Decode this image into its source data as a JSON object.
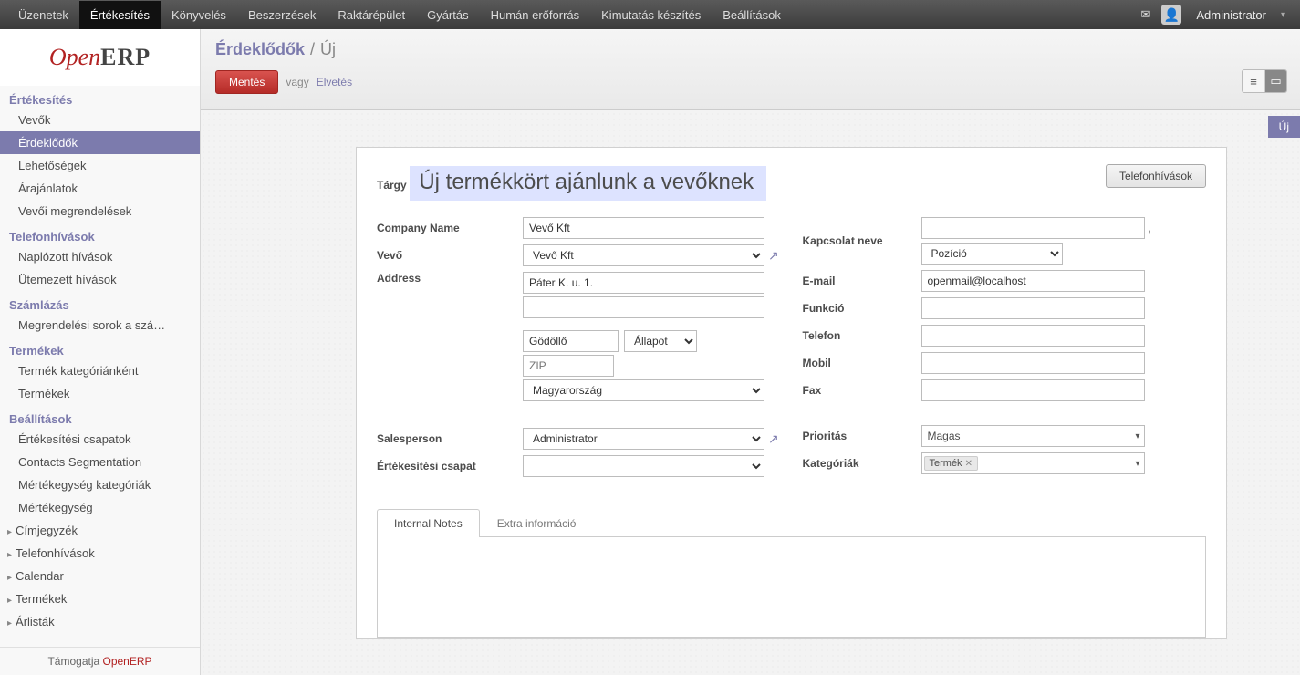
{
  "topmenu": {
    "items": [
      "Üzenetek",
      "Értékesítés",
      "Könyvelés",
      "Beszerzések",
      "Raktárépület",
      "Gyártás",
      "Humán erőforrás",
      "Kimutatás készítés",
      "Beállítások"
    ],
    "active_index": 1,
    "username": "Administrator"
  },
  "logo": {
    "open": "Open",
    "erp": "ERP"
  },
  "sidebar": {
    "sections": [
      {
        "title": "Értékesítés",
        "items": [
          {
            "label": "Vevők"
          },
          {
            "label": "Érdeklődők",
            "active": true
          },
          {
            "label": "Lehetőségek"
          },
          {
            "label": "Árajánlatok"
          },
          {
            "label": "Vevői megrendelések"
          }
        ]
      },
      {
        "title": "Telefonhívások",
        "items": [
          {
            "label": "Naplózott hívások"
          },
          {
            "label": "Ütemezett hívások"
          }
        ]
      },
      {
        "title": "Számlázás",
        "items": [
          {
            "label": "Megrendelési sorok a szá…"
          }
        ]
      },
      {
        "title": "Termékek",
        "items": [
          {
            "label": "Termék kategóriánként"
          },
          {
            "label": "Termékek"
          }
        ]
      },
      {
        "title": "Beállítások",
        "items": [
          {
            "label": "Értékesítési csapatok"
          },
          {
            "label": "Contacts Segmentation"
          },
          {
            "label": "Mértékegység kategóriák"
          },
          {
            "label": "Mértékegység"
          },
          {
            "label": "Címjegyzék",
            "expandable": true
          },
          {
            "label": "Telefonhívások",
            "expandable": true
          },
          {
            "label": "Calendar",
            "expandable": true
          },
          {
            "label": "Termékek",
            "expandable": true
          },
          {
            "label": "Árlisták",
            "expandable": true
          }
        ]
      }
    ],
    "footer_prefix": "Támogatja ",
    "footer_brand": "OpenERP"
  },
  "header": {
    "breadcrumb_root": "Érdeklődők",
    "breadcrumb_current": "Új",
    "save": "Mentés",
    "or": "vagy",
    "discard": "Elvetés",
    "status_tag": "Új"
  },
  "form": {
    "subject_label": "Tárgy",
    "subject_value": "Új termékkört ajánlunk a vevőknek",
    "phone_calls_button": "Telefonhívások",
    "company_name_label": "Company Name",
    "company_name_value": "Vevő Kft",
    "customer_label": "Vevő",
    "customer_value": "Vevő Kft",
    "address_label": "Address",
    "street_value": "Páter K. u. 1.",
    "street2_value": "",
    "city_value": "Gödöllő",
    "state_placeholder": "Állapot",
    "zip_placeholder": "ZIP",
    "zip_value": "",
    "country_value": "Magyarország",
    "salesperson_label": "Salesperson",
    "salesperson_value": "Administrator",
    "sales_team_label": "Értékesítési csapat",
    "sales_team_value": "",
    "contact_name_label": "Kapcsolat neve",
    "contact_name_value": "",
    "title_placeholder": "Pozíció",
    "email_label": "E-mail",
    "email_value": "openmail@localhost",
    "function_label": "Funkció",
    "function_value": "",
    "phone_label": "Telefon",
    "phone_value": "",
    "mobile_label": "Mobil",
    "mobile_value": "",
    "fax_label": "Fax",
    "fax_value": "",
    "priority_label": "Prioritás",
    "priority_value": "Magas",
    "categories_label": "Kategóriák",
    "category_tag": "Termék",
    "tab_notes": "Internal Notes",
    "tab_extra": "Extra információ"
  }
}
